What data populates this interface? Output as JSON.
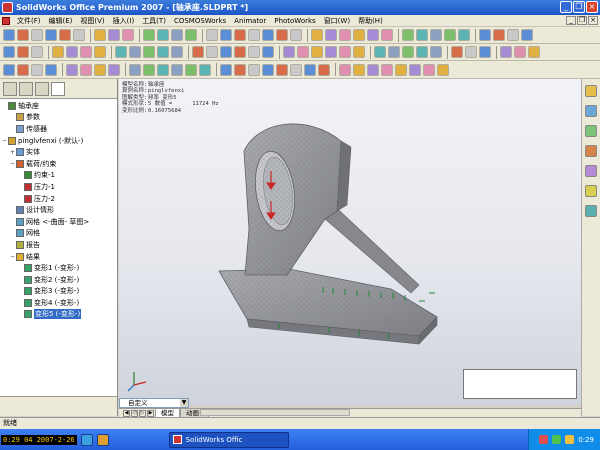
{
  "window": {
    "title": "SolidWorks Office Premium 2007 - [轴承座.SLDPRT *]"
  },
  "menu": [
    "文件(F)",
    "编辑(E)",
    "视图(V)",
    "插入(I)",
    "工具(T)",
    "COSMOSWorks",
    "Animator",
    "PhotoWorks",
    "窗口(W)",
    "帮助(H)"
  ],
  "feature_tree": {
    "items": [
      {
        "label": "轴承座",
        "level": 0,
        "expander": "",
        "icon_color": "#4a8a3a"
      },
      {
        "label": "参数",
        "level": 1,
        "expander": "",
        "icon_color": "#c9a34a"
      },
      {
        "label": "传感器",
        "level": 1,
        "expander": "",
        "icon_color": "#7aa0d0"
      },
      {
        "label": "pinglvfenxi (-默认-)",
        "level": 0,
        "expander": "−",
        "icon_color": "#d0a030"
      },
      {
        "label": "实体",
        "level": 1,
        "expander": "+",
        "icon_color": "#6a9ad6"
      },
      {
        "label": "载荷/约束",
        "level": 1,
        "expander": "−",
        "icon_color": "#d06030"
      },
      {
        "label": "约束-1",
        "level": 2,
        "expander": "",
        "icon_color": "#3a8a3a"
      },
      {
        "label": "压力-1",
        "level": 2,
        "expander": "",
        "icon_color": "#c03030"
      },
      {
        "label": "压力-2",
        "level": 2,
        "expander": "",
        "icon_color": "#c03030"
      },
      {
        "label": "设计情形",
        "level": 1,
        "expander": "",
        "icon_color": "#6080b0"
      },
      {
        "label": "网格 <-曲面- 草图>",
        "level": 1,
        "expander": "",
        "icon_color": "#5aa0c0"
      },
      {
        "label": "网格",
        "level": 1,
        "expander": "",
        "icon_color": "#5aa0c0"
      },
      {
        "label": "报告",
        "level": 1,
        "expander": "",
        "icon_color": "#b0b040"
      },
      {
        "label": "结果",
        "level": 1,
        "expander": "−",
        "icon_color": "#e0b030"
      },
      {
        "label": "变形1 (-变形-)",
        "level": 2,
        "expander": "",
        "icon_color": "#3aa06a"
      },
      {
        "label": "变形2 (-变形-)",
        "level": 2,
        "expander": "",
        "icon_color": "#3aa06a"
      },
      {
        "label": "变形3 (-变形-)",
        "level": 2,
        "expander": "",
        "icon_color": "#3aa06a"
      },
      {
        "label": "变形4 (-变形-)",
        "level": 2,
        "expander": "",
        "icon_color": "#3aa06a"
      },
      {
        "label": "变形5 (-变形-)",
        "level": 2,
        "expander": "",
        "icon_color": "#3aa06a",
        "selected": true
      }
    ]
  },
  "viewport_info": {
    "rows": [
      {
        "k": "模型名称:",
        "v": "轴承座"
      },
      {
        "k": "算例名称:",
        "v": "pinglvfenxi"
      },
      {
        "k": "图解类型:",
        "v": "频率 变形5"
      },
      {
        "k": "模式形状:",
        "v": "5  数值 =",
        "v2": "11724 Hz"
      },
      {
        "k": "变形比例:",
        "v": "0.16075684"
      }
    ]
  },
  "bottom": {
    "dropdown": "自定义",
    "tab_model": "模型",
    "tab_animation": "动画1"
  },
  "status": "就绪",
  "taskbar": {
    "clock_left": "0:29 04 2007-2-26",
    "task_label": "SolidWorks Offic",
    "clock_right": "0:29"
  },
  "colors": {
    "title_bar": "#245edb",
    "selection": "#316ac5",
    "part": "#8d8f94"
  }
}
